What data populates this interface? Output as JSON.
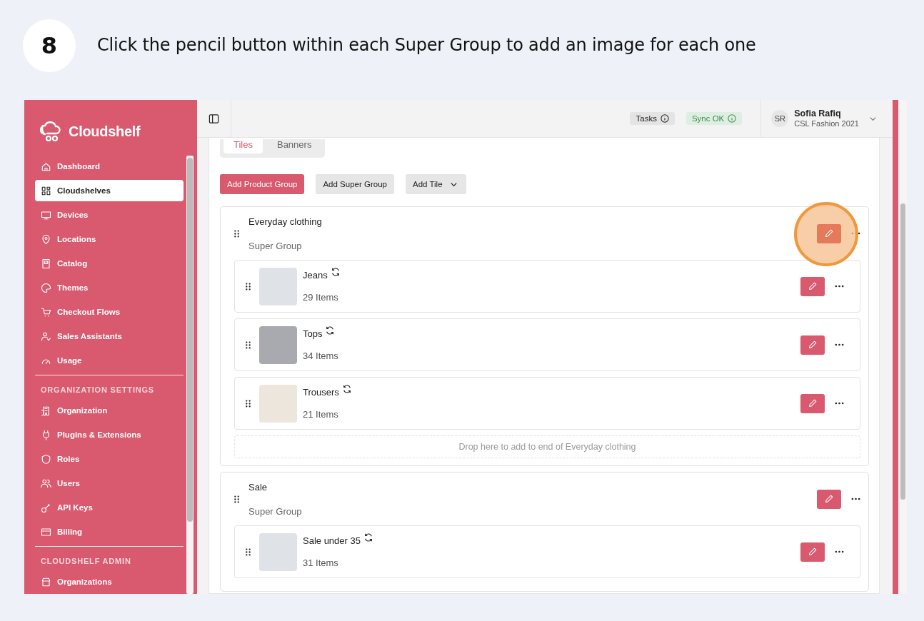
{
  "step": {
    "number": "8",
    "instruction": "Click the pencil button within each Super Group to add an image for each one"
  },
  "sidebar": {
    "brand": "Cloudshelf",
    "items": [
      {
        "label": "Dashboard",
        "selected": false
      },
      {
        "label": "Cloudshelves",
        "selected": true
      },
      {
        "label": "Devices",
        "selected": false
      },
      {
        "label": "Locations",
        "selected": false
      },
      {
        "label": "Catalog",
        "selected": false
      },
      {
        "label": "Themes",
        "selected": false
      },
      {
        "label": "Checkout Flows",
        "selected": false
      },
      {
        "label": "Sales Assistants",
        "selected": false
      },
      {
        "label": "Usage",
        "selected": false
      }
    ],
    "sections": [
      {
        "title": "ORGANIZATION SETTINGS",
        "items": [
          {
            "label": "Organization",
            "selected": false
          },
          {
            "label": "Plugins & Extensions",
            "selected": false
          },
          {
            "label": "Roles",
            "selected": false
          },
          {
            "label": "Users",
            "selected": false
          },
          {
            "label": "API Keys",
            "selected": false
          },
          {
            "label": "Billing",
            "selected": false
          }
        ]
      },
      {
        "title": "CLOUDSHELF ADMIN",
        "items": [
          {
            "label": "Organizations",
            "selected": false
          }
        ]
      }
    ]
  },
  "topbar": {
    "tasks": "Tasks",
    "sync": "Sync OK",
    "user": {
      "initials": "SR",
      "name": "Sofia Rafiq",
      "org": "CSL Fashion 2021"
    }
  },
  "tabs": [
    {
      "label": "Tiles",
      "selected": true
    },
    {
      "label": "Banners",
      "selected": false
    }
  ],
  "toolbar": [
    {
      "label": "Add Product Group",
      "kind": "primary"
    },
    {
      "label": "Add Super Group",
      "kind": "secondary"
    },
    {
      "label": "Add Tile",
      "kind": "dropdown"
    }
  ],
  "groups": [
    {
      "title": "Everyday clothing",
      "subtitle": "Super Group",
      "highlighted": true,
      "drop_hint": "Drop here to add to end of Everyday clothing",
      "items": [
        {
          "name": "Jeans",
          "count": "29 Items"
        },
        {
          "name": "Tops",
          "count": "34 Items"
        },
        {
          "name": "Trousers",
          "count": "21 Items"
        }
      ]
    },
    {
      "title": "Sale",
      "subtitle": "Super Group",
      "highlighted": false,
      "items": [
        {
          "name": "Sale under 35",
          "count": "31 Items"
        }
      ]
    }
  ]
}
